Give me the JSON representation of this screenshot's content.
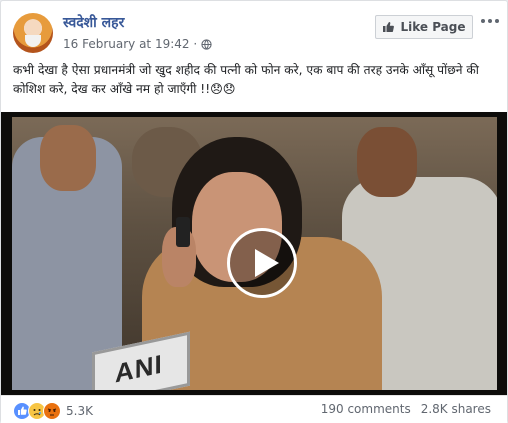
{
  "post": {
    "page_name": "स्वदेशी लहर",
    "timestamp": "16 February at 19:42 · ",
    "privacy_icon": "globe-icon",
    "like_page_label": "Like Page",
    "text_parts": [
      "कभी देखा है ऐसा प्रधानमंत्री जो खुद शहीद की पत्नी को फोन करे, एक बाप की तरह उनके आँसू पोंछने की कोशिश करे, देख कर आँखे नम हो जाएँगी !!😞😞"
    ]
  },
  "video": {
    "overlay_logo": "ANI",
    "play_icon": "play-icon"
  },
  "stats": {
    "reaction_count": "5.3K",
    "comments": "190 comments",
    "shares": "2.8K shares"
  },
  "colors": {
    "link_blue": "#385898",
    "highlight": "#c9daf8",
    "like_blue": "#5890ff"
  }
}
